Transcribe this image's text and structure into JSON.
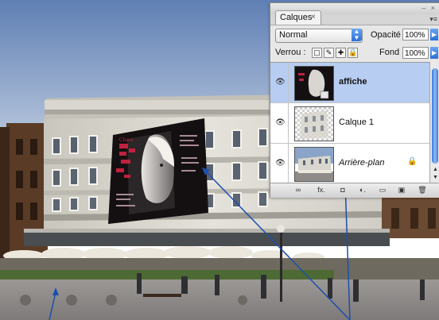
{
  "panel": {
    "tab_label": "Calques",
    "tab_close": "×",
    "window_controls": "– ×",
    "menu_glyph": "▾≡",
    "blend_mode": "Normal",
    "opacity_label": "Opacité :",
    "opacity_value": "100%",
    "lock_label": "Verrou :",
    "fill_label": "Fond :",
    "fill_value": "100%",
    "layers": [
      {
        "name": "affiche",
        "selected": true,
        "visible": true
      },
      {
        "name": "Calque 1",
        "selected": false,
        "visible": true
      },
      {
        "name": "Arrière-plan",
        "selected": false,
        "visible": true,
        "locked": true
      }
    ],
    "footer_buttons": [
      {
        "icon": "link-icon",
        "glyph": "∞"
      },
      {
        "icon": "fx-icon",
        "glyph": "fx."
      },
      {
        "icon": "mask-icon",
        "glyph": "◘"
      },
      {
        "icon": "adjustment-icon",
        "glyph": "◐."
      },
      {
        "icon": "folder-icon",
        "glyph": "▭"
      },
      {
        "icon": "new-layer-icon",
        "glyph": "▣"
      },
      {
        "icon": "trash-icon",
        "glyph": "🗑"
      }
    ]
  },
  "poster": {
    "title_text": "Chaos"
  },
  "colors": {
    "sky": "#89a3c8",
    "facade": "#d9d7cf",
    "poster_bg": "#141012",
    "poster_accent": "#c0213e",
    "arrow": "#1d4fae",
    "selection": "#b7cdf1"
  }
}
